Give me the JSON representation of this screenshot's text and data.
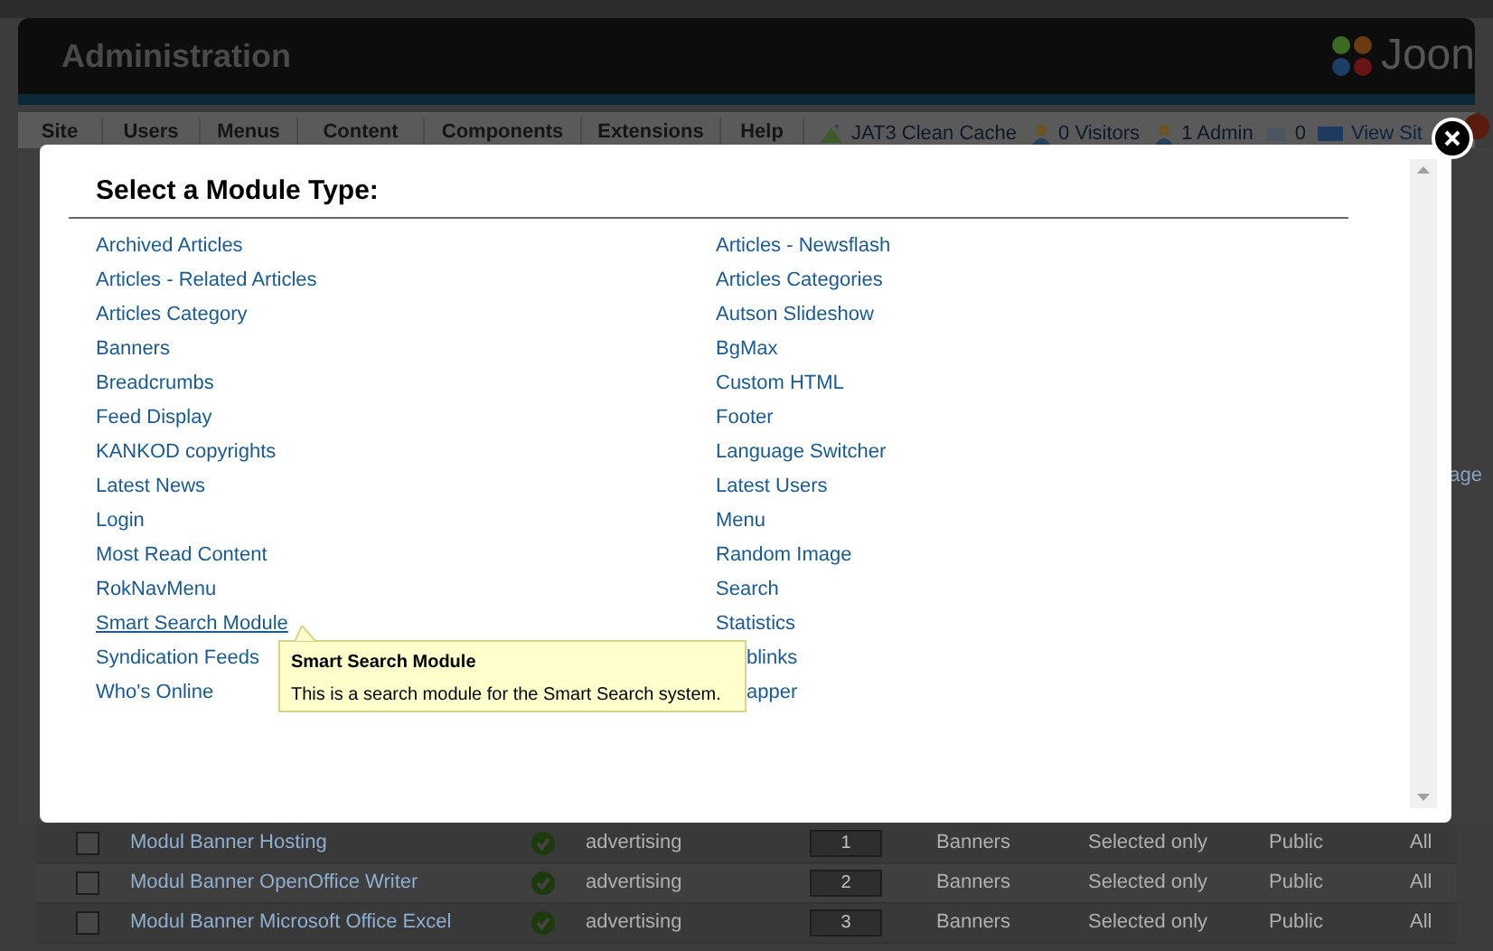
{
  "header": {
    "title": "Administration",
    "logo_text": "Joon"
  },
  "menu": {
    "items": [
      "Site",
      "Users",
      "Menus",
      "Content",
      "Components",
      "Extensions",
      "Help"
    ],
    "status": [
      {
        "kind": "cache",
        "text": "JAT3 Clean Cache"
      },
      {
        "kind": "visitors",
        "text": "0 Visitors"
      },
      {
        "kind": "admin",
        "text": "1 Admin"
      },
      {
        "kind": "messages",
        "text": "0"
      },
      {
        "kind": "view",
        "text": "View Sit"
      }
    ]
  },
  "background_fragment": "age",
  "modules_table": {
    "rows": [
      {
        "checked": false,
        "name": "Modul Banner Hosting",
        "published": true,
        "position": "advertising",
        "order": "1",
        "type": "Banners",
        "pages": "Selected only",
        "access": "Public",
        "language": "All"
      },
      {
        "checked": false,
        "name": "Modul Banner OpenOffice Writer",
        "published": true,
        "position": "advertising",
        "order": "2",
        "type": "Banners",
        "pages": "Selected only",
        "access": "Public",
        "language": "All"
      },
      {
        "checked": false,
        "name": "Modul Banner Microsoft Office Excel",
        "published": true,
        "position": "advertising",
        "order": "3",
        "type": "Banners",
        "pages": "Selected only",
        "access": "Public",
        "language": "All"
      }
    ]
  },
  "modal": {
    "title": "Select a Module Type:",
    "columns": [
      [
        {
          "label": "Archived Articles",
          "hovered": false
        },
        {
          "label": "Articles - Related Articles",
          "hovered": false
        },
        {
          "label": "Articles Category",
          "hovered": false
        },
        {
          "label": "Banners",
          "hovered": false
        },
        {
          "label": "Breadcrumbs",
          "hovered": false
        },
        {
          "label": "Feed Display",
          "hovered": false
        },
        {
          "label": "KANKOD copyrights",
          "hovered": false
        },
        {
          "label": "Latest News",
          "hovered": false
        },
        {
          "label": "Login",
          "hovered": false
        },
        {
          "label": "Most Read Content",
          "hovered": false
        },
        {
          "label": "RokNavMenu",
          "hovered": false
        },
        {
          "label": "Smart Search Module",
          "hovered": true
        },
        {
          "label": "Syndication Feeds",
          "hovered": false
        },
        {
          "label": "Who's Online",
          "hovered": false
        }
      ],
      [
        {
          "label": "Articles - Newsflash",
          "hovered": false
        },
        {
          "label": "Articles Categories",
          "hovered": false
        },
        {
          "label": "Autson Slideshow",
          "hovered": false
        },
        {
          "label": "BgMax",
          "hovered": false
        },
        {
          "label": "Custom HTML",
          "hovered": false
        },
        {
          "label": "Footer",
          "hovered": false
        },
        {
          "label": "Language Switcher",
          "hovered": false
        },
        {
          "label": "Latest Users",
          "hovered": false
        },
        {
          "label": "Menu",
          "hovered": false
        },
        {
          "label": "Random Image",
          "hovered": false
        },
        {
          "label": "Search",
          "hovered": false
        },
        {
          "label": "Statistics",
          "hovered": false
        },
        {
          "label": "blinks",
          "hovered": false,
          "kind": "partial"
        },
        {
          "label": "apper",
          "hovered": false,
          "kind": "partial"
        }
      ]
    ],
    "tooltip": {
      "title": "Smart Search Module",
      "text": "This is a search module for the Smart Search system."
    }
  }
}
